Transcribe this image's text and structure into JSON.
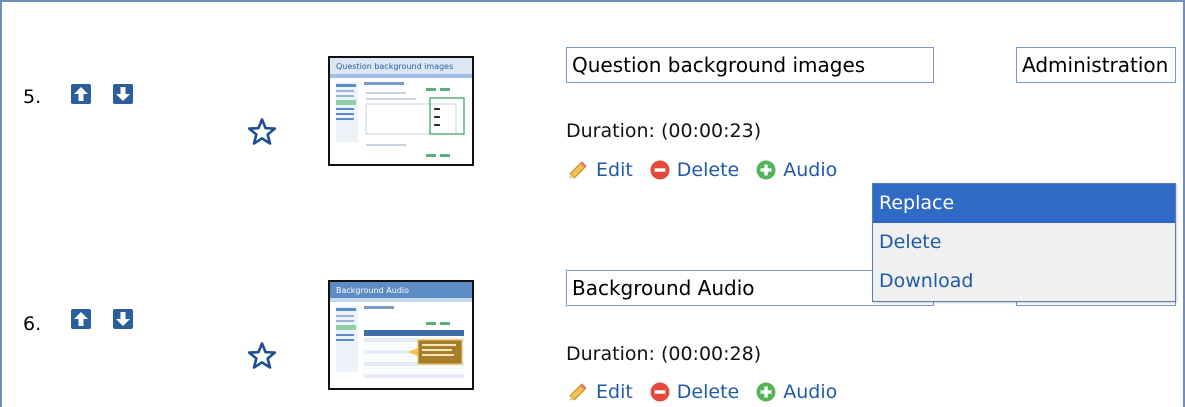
{
  "rows": [
    {
      "number": "5.",
      "title": "Question background images",
      "category": "Administration",
      "duration": "Duration: (00:00:23)",
      "thumb_title": "Question background images",
      "actions": {
        "edit": "Edit",
        "delete": "Delete",
        "audio": "Audio"
      }
    },
    {
      "number": "6.",
      "title": "Background Audio",
      "category": "",
      "duration": "Duration: (00:00:28)",
      "thumb_title": "Background Audio",
      "actions": {
        "edit": "Edit",
        "delete": "Delete",
        "audio": "Audio"
      }
    }
  ],
  "audio_menu": {
    "items": [
      "Replace",
      "Delete",
      "Download"
    ],
    "selected": "Replace"
  },
  "colors": {
    "link": "#1f5aa8",
    "arrow_bg": "#2c5d9c",
    "menu_highlight": "#2f6ac6",
    "border": "#6f8fb8"
  },
  "icons": {
    "move_up": "arrow-up-icon",
    "move_down": "arrow-down-icon",
    "favorite": "star-outline-icon",
    "edit": "pencil-icon",
    "delete": "minus-circle-icon",
    "audio": "plus-circle-icon"
  }
}
